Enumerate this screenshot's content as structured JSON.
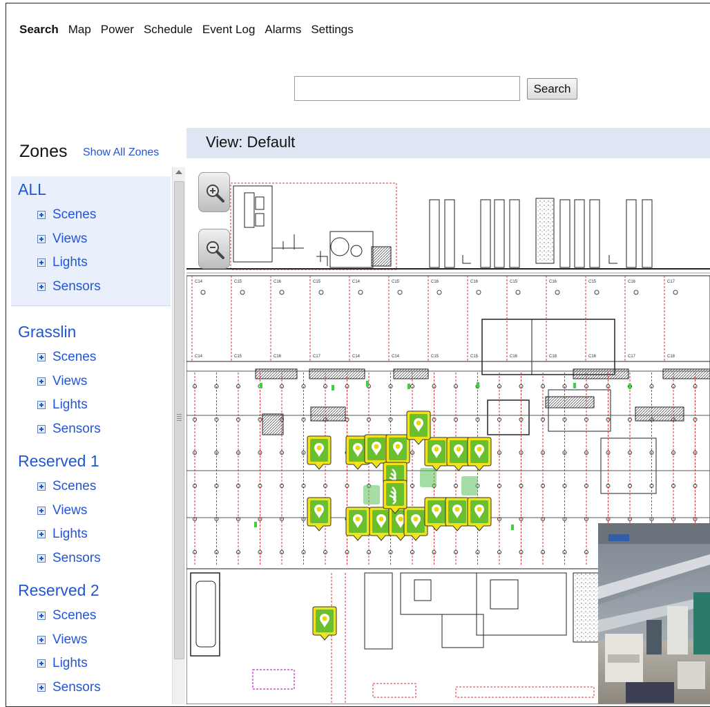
{
  "nav": {
    "items": [
      "Search",
      "Map",
      "Power",
      "Schedule",
      "Event Log",
      "Alarms",
      "Settings"
    ],
    "active": "Search"
  },
  "search": {
    "value": "",
    "placeholder": "",
    "button_label": "Search"
  },
  "sidebar": {
    "title": "Zones",
    "show_all_label": "Show All Zones",
    "zones": [
      {
        "name": "ALL",
        "items": [
          "Scenes",
          "Views",
          "Lights",
          "Sensors"
        ],
        "selected": true
      },
      {
        "name": "Grasslin",
        "items": [
          "Scenes",
          "Views",
          "Lights",
          "Sensors"
        ]
      },
      {
        "name": "Reserved 1",
        "items": [
          "Scenes",
          "Views",
          "Lights",
          "Sensors"
        ]
      },
      {
        "name": "Reserved 2",
        "items": [
          "Scenes",
          "Views",
          "Lights",
          "Sensors"
        ]
      }
    ]
  },
  "view": {
    "title": "View: Default"
  },
  "map": {
    "zoom_in_icon": "zoom-in-icon",
    "zoom_out_icon": "zoom-out-icon",
    "light_icon": "light-bulb-marker-icon",
    "sensor_icon": "sensor-marker-icon",
    "marker_color": "#6abf2e",
    "marker_border": "#f2e21a",
    "top_labels": [
      "C14",
      "C15",
      "C16",
      "C15",
      "C14",
      "C15",
      "C16",
      "C16",
      "C15",
      "C16",
      "C15",
      "C16",
      "C17"
    ],
    "mid_labels": [
      "C14",
      "C15",
      "C16",
      "C17",
      "C14",
      "C14",
      "C15",
      "C15",
      "C16",
      "C18",
      "C16",
      "C17",
      "C18"
    ]
  },
  "colors": {
    "link": "#2155d6",
    "view_header_bg": "#dfe7f5",
    "zone_selected_bg": "#eaf0fb"
  }
}
